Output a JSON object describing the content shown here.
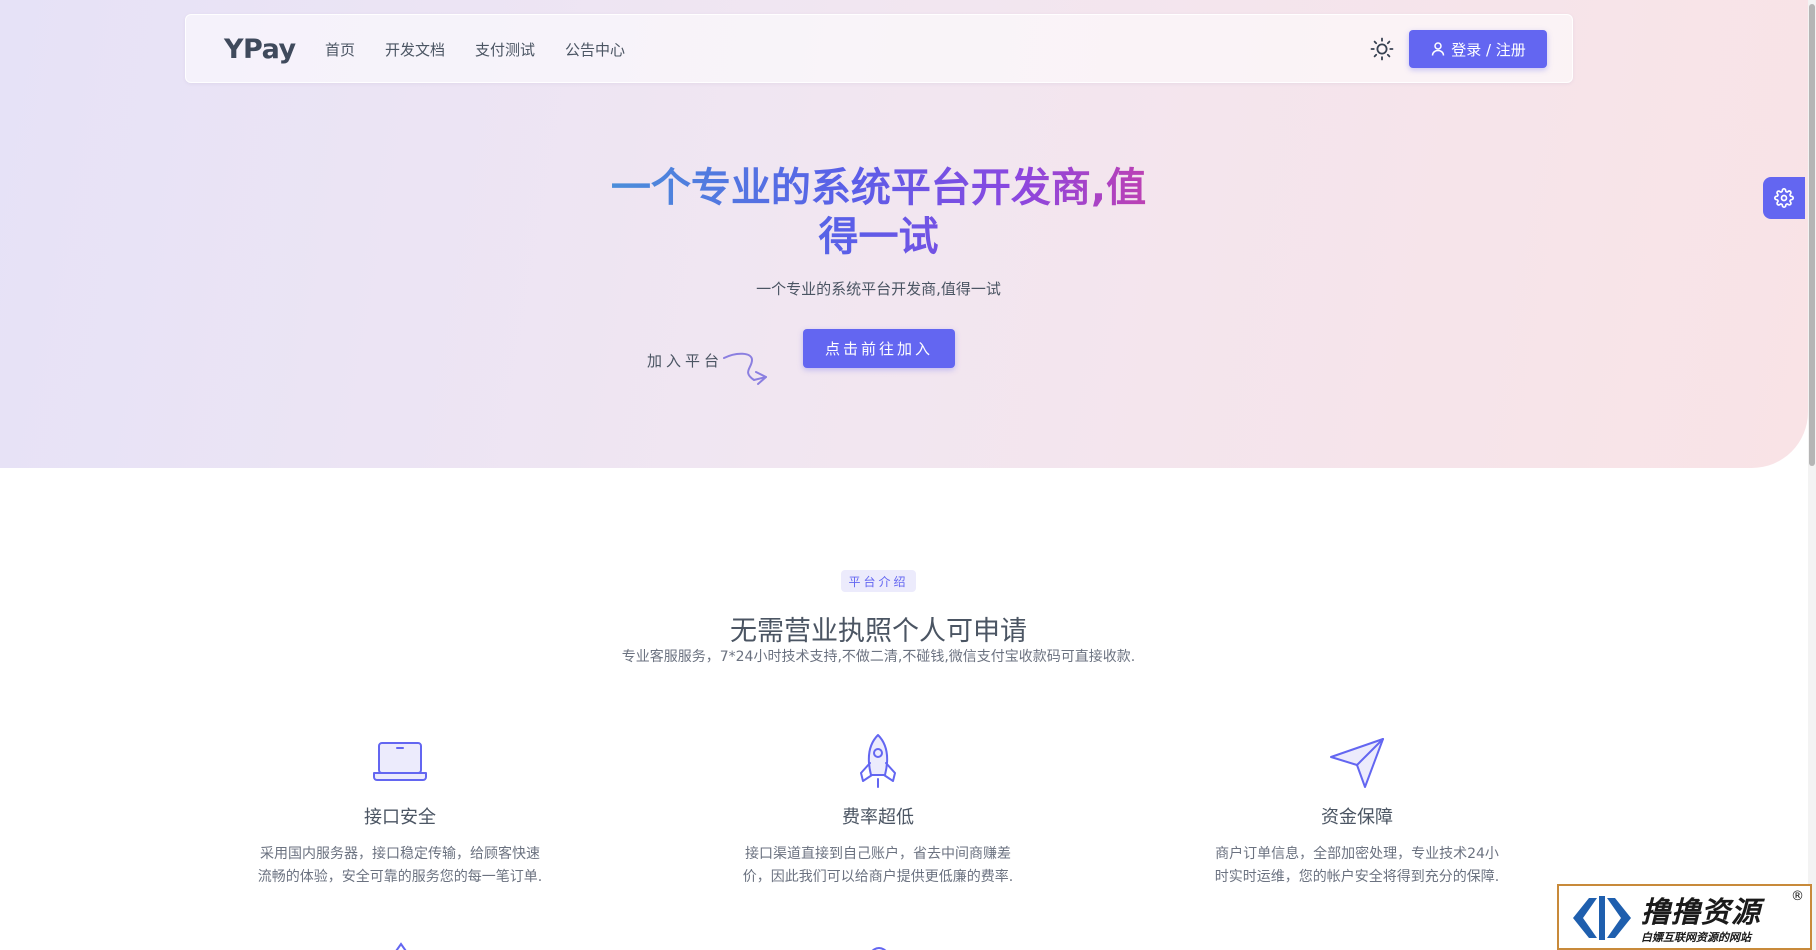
{
  "nav": {
    "brand": "YPay",
    "links": [
      "首页",
      "开发文档",
      "支付测试",
      "公告中心"
    ],
    "login_label": "登录 / 注册"
  },
  "hero": {
    "title": "一个专业的系统平台开发商,值得一试",
    "subtitle": "一个专业的系统平台开发商,值得一试",
    "cta_label": "加入平台",
    "cta_button": "点击前往加入"
  },
  "section": {
    "badge": "平台介绍",
    "title": "无需营业执照个人可申请",
    "desc": "专业客服服务，7*24小时技术支持,不做二清,不碰钱,微信支付宝收款码可直接收款."
  },
  "features": [
    {
      "icon": "laptop-icon",
      "title": "接口安全",
      "desc": "采用国内服务器，接口稳定传输，给顾客快速流畅的体验，安全可靠的服务您的每一笔订单."
    },
    {
      "icon": "rocket-icon",
      "title": "费率超低",
      "desc": "接口渠道直接到自己账户，省去中间商赚差价，因此我们可以给商户提供更低廉的费率."
    },
    {
      "icon": "paper-plane-icon",
      "title": "资金保障",
      "desc": "商户订单信息，全部加密处理，专业技术24小时实时运维，您的帐户安全将得到充分的保障."
    }
  ],
  "watermark": {
    "title": "撸撸资源",
    "subtitle": "白嫖互联网资源的网站",
    "reg": "®"
  },
  "colors": {
    "accent": "#6366f1",
    "hero_bg_start": "#e6e2f7",
    "hero_bg_end": "#f9e3e6"
  }
}
